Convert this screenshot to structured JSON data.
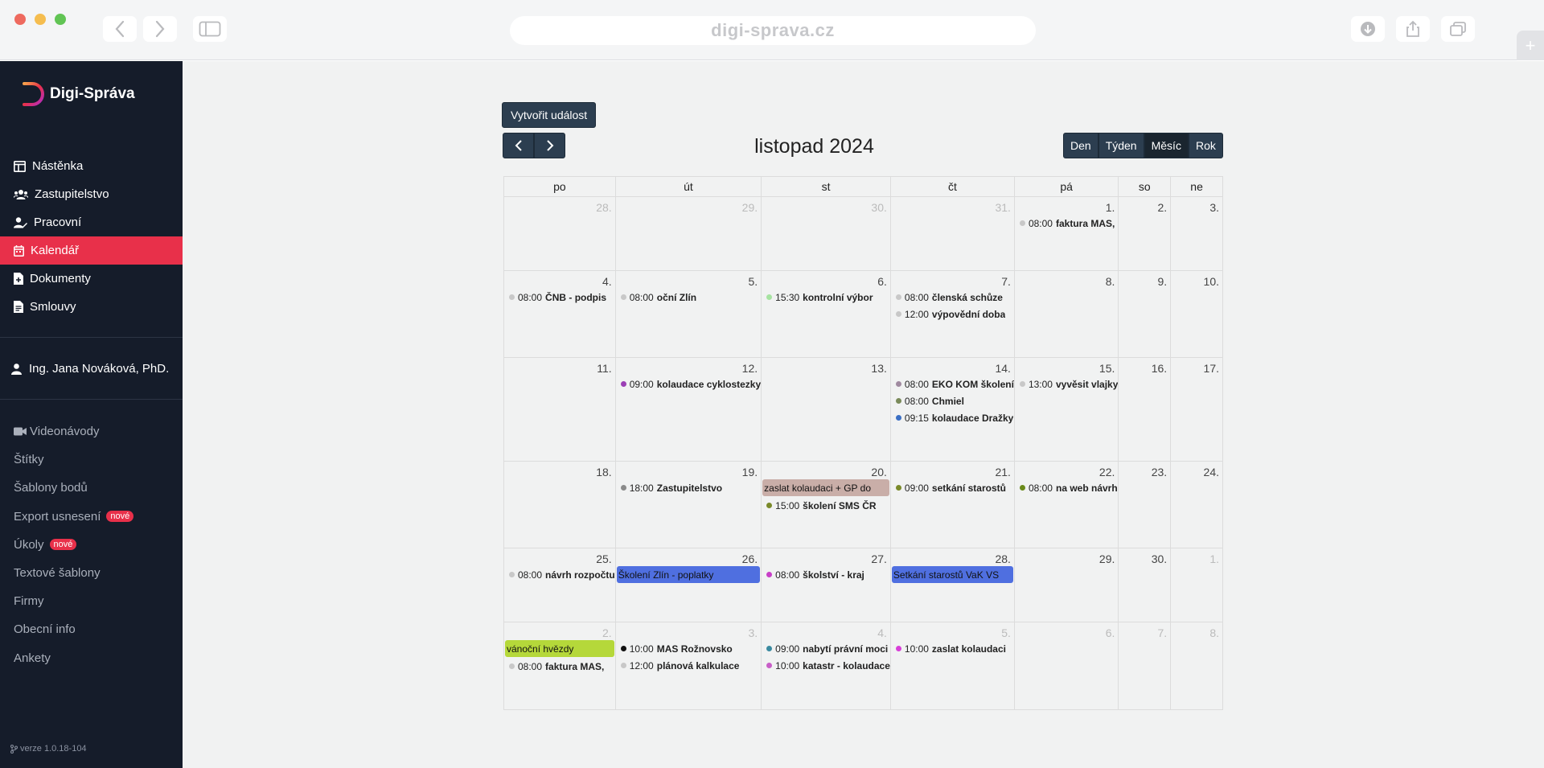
{
  "browser": {
    "url": "digi-sprava.cz"
  },
  "app": {
    "logo_text": "Digi-Správa",
    "version": "verze 1.0.18-104"
  },
  "sidebar": {
    "items": [
      {
        "label": "Nástěnka",
        "icon": "dashboard-icon"
      },
      {
        "label": "Zastupitelstvo",
        "icon": "users-icon"
      },
      {
        "label": "Pracovní",
        "icon": "user-edit-icon"
      },
      {
        "label": "Kalendář",
        "icon": "calendar-icon",
        "active": true
      },
      {
        "label": "Dokumenty",
        "icon": "file-plus-icon"
      },
      {
        "label": "Smlouvy",
        "icon": "file-text-icon"
      }
    ],
    "user": "Ing. Jana Nováková, PhD.",
    "secondary": [
      {
        "label": "Videonávody",
        "icon": "video-icon"
      },
      {
        "label": "Štítky"
      },
      {
        "label": "Šablony bodů"
      },
      {
        "label": "Export usnesení",
        "badge": "nové"
      },
      {
        "label": "Úkoly",
        "badge": "nové"
      },
      {
        "label": "Textové šablony"
      },
      {
        "label": "Firmy"
      },
      {
        "label": "Obecní info"
      },
      {
        "label": "Ankety"
      }
    ]
  },
  "calendar": {
    "create_label": "Vytvořit událost",
    "title": "listopad 2024",
    "views": [
      "Den",
      "Týden",
      "Měsíc",
      "Rok"
    ],
    "active_view": "Měsíc",
    "weekdays": [
      "po",
      "út",
      "st",
      "čt",
      "pá",
      "so",
      "ne"
    ],
    "weeks": [
      [
        {
          "day": "28.",
          "other": true,
          "events": []
        },
        {
          "day": "29.",
          "other": true,
          "events": []
        },
        {
          "day": "30.",
          "other": true,
          "events": []
        },
        {
          "day": "31.",
          "other": true,
          "events": []
        },
        {
          "day": "1.",
          "events": [
            {
              "time": "08:00",
              "title": "faktura MAS, ",
              "color": "#c8c8c8"
            }
          ]
        },
        {
          "day": "2.",
          "events": []
        },
        {
          "day": "3.",
          "events": []
        }
      ],
      [
        {
          "day": "4.",
          "events": [
            {
              "time": "08:00",
              "title": "ČNB - podpis",
              "color": "#c8c8c8"
            }
          ]
        },
        {
          "day": "5.",
          "events": [
            {
              "time": "08:00",
              "title": "oční Zlín",
              "color": "#c8c8c8"
            }
          ]
        },
        {
          "day": "6.",
          "events": [
            {
              "time": "15:30",
              "title": "kontrolní výbor",
              "color": "#a6e3a1"
            }
          ]
        },
        {
          "day": "7.",
          "events": [
            {
              "time": "08:00",
              "title": "členská schůze",
              "color": "#c8c8c8"
            },
            {
              "time": "12:00",
              "title": "výpovědní doba",
              "color": "#c8c8c8"
            }
          ]
        },
        {
          "day": "8.",
          "events": []
        },
        {
          "day": "9.",
          "events": []
        },
        {
          "day": "10.",
          "events": []
        }
      ],
      [
        {
          "day": "11.",
          "events": []
        },
        {
          "day": "12.",
          "events": [
            {
              "time": "09:00",
              "title": "kolaudace cyklostezky",
              "color": "#9b3fb5"
            }
          ]
        },
        {
          "day": "13.",
          "events": []
        },
        {
          "day": "14.",
          "events": [
            {
              "time": "08:00",
              "title": "EKO KOM školení",
              "color": "#a08aa0"
            },
            {
              "time": "08:00",
              "title": "Chmiel",
              "color": "#7a8a5a"
            },
            {
              "time": "09:15",
              "title": "kolaudace Dražky",
              "color": "#3b6fc4"
            }
          ]
        },
        {
          "day": "15.",
          "events": [
            {
              "time": "13:00",
              "title": "vyvěsit vlajky",
              "color": "#c8c8c8"
            }
          ]
        },
        {
          "day": "16.",
          "events": []
        },
        {
          "day": "17.",
          "events": []
        }
      ],
      [
        {
          "day": "18.",
          "events": []
        },
        {
          "day": "19.",
          "events": [
            {
              "time": "18:00",
              "title": "Zastupitelstvo",
              "color": "#8a8a8a"
            }
          ]
        },
        {
          "day": "20.",
          "events": [
            {
              "bar": "zaslat kolaudaci + GP do",
              "color": "#c9aea8"
            },
            {
              "time": "15:00",
              "title": "školení SMS ČR",
              "color": "#7a8a2a"
            }
          ]
        },
        {
          "day": "21.",
          "events": [
            {
              "time": "09:00",
              "title": "setkání starostů",
              "color": "#7a8a2a"
            }
          ]
        },
        {
          "day": "22.",
          "events": [
            {
              "time": "08:00",
              "title": "na web návrh",
              "color": "#6a8a1a"
            }
          ]
        },
        {
          "day": "23.",
          "events": []
        },
        {
          "day": "24.",
          "events": []
        }
      ],
      [
        {
          "day": "25.",
          "events": [
            {
              "time": "08:00",
              "title": "návrh rozpočtu",
              "color": "#c8c8c8"
            }
          ]
        },
        {
          "day": "26.",
          "events": [
            {
              "bar": "Školení Zlín - poplatky",
              "color": "#4f6fe0"
            }
          ]
        },
        {
          "day": "27.",
          "events": [
            {
              "time": "08:00",
              "title": "školství - kraj",
              "color": "#c83fc8"
            }
          ]
        },
        {
          "day": "28.",
          "events": [
            {
              "bar": "Setkání starostů VaK VS",
              "color": "#4f6fe0"
            }
          ]
        },
        {
          "day": "29.",
          "events": []
        },
        {
          "day": "30.",
          "events": []
        },
        {
          "day": "1.",
          "other": true,
          "events": []
        }
      ],
      [
        {
          "day": "2.",
          "other": true,
          "events": [
            {
              "bar": "vánoční hvězdy",
              "color": "#b5d83a"
            },
            {
              "time": "08:00",
              "title": "faktura MAS, ",
              "color": "#c8c8c8"
            }
          ]
        },
        {
          "day": "3.",
          "other": true,
          "events": [
            {
              "time": "10:00",
              "title": "MAS Rožnovsko",
              "color": "#111111"
            },
            {
              "time": "12:00",
              "title": "plánová kalkulace",
              "color": "#c8c8c8"
            }
          ]
        },
        {
          "day": "4.",
          "other": true,
          "events": [
            {
              "time": "09:00",
              "title": "nabytí právní moci",
              "color": "#3a8aa0"
            },
            {
              "time": "10:00",
              "title": "katastr - kolaudace",
              "color": "#c85fc8"
            }
          ]
        },
        {
          "day": "5.",
          "other": true,
          "events": [
            {
              "time": "10:00",
              "title": "zaslat kolaudaci",
              "color": "#d83fd8"
            }
          ]
        },
        {
          "day": "6.",
          "other": true,
          "events": []
        },
        {
          "day": "7.",
          "other": true,
          "events": []
        },
        {
          "day": "8.",
          "other": true,
          "events": []
        }
      ]
    ]
  }
}
